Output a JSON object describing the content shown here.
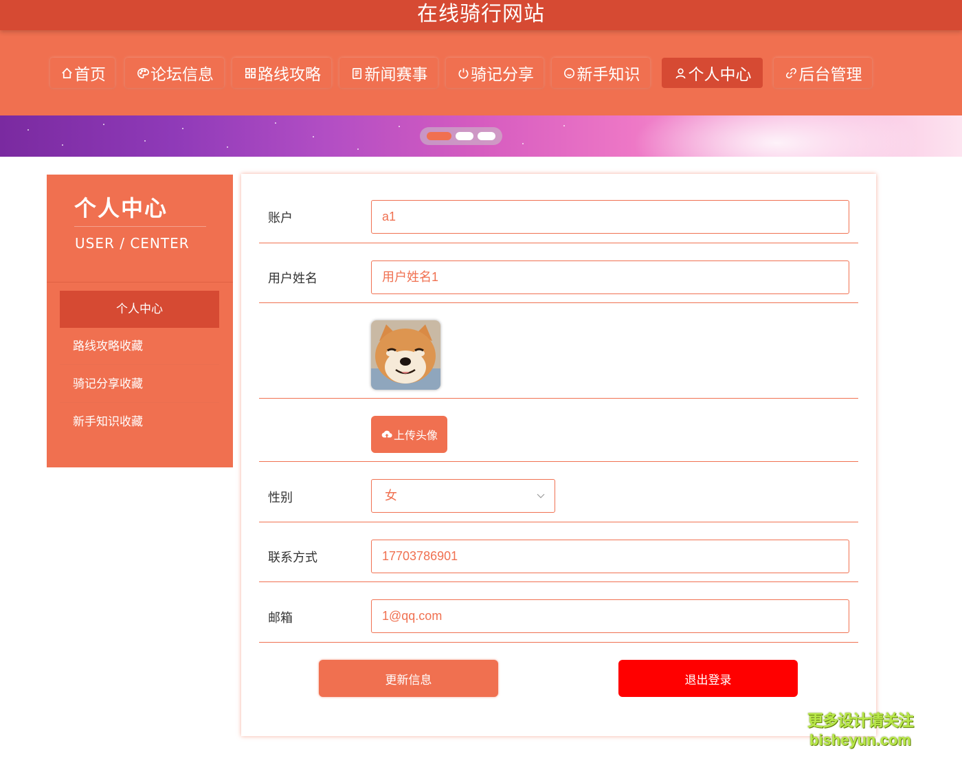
{
  "site": {
    "title": "在线骑行网站"
  },
  "nav": {
    "items": [
      {
        "label": "首页",
        "icon": "home-icon"
      },
      {
        "label": "论坛信息",
        "icon": "palette-icon"
      },
      {
        "label": "路线攻略",
        "icon": "grid-icon"
      },
      {
        "label": "新闻赛事",
        "icon": "clipboard-icon"
      },
      {
        "label": "骑记分享",
        "icon": "power-icon"
      },
      {
        "label": "新手知识",
        "icon": "circle-icon"
      },
      {
        "label": "个人中心",
        "icon": "user-icon",
        "active": true
      },
      {
        "label": "后台管理",
        "icon": "link-icon"
      }
    ]
  },
  "banner": {
    "slide_count": 3,
    "active_slide": 1
  },
  "sidebar": {
    "title": "个人中心",
    "subtitle": "USER / CENTER",
    "items": [
      {
        "label": "个人中心",
        "active": true
      },
      {
        "label": "路线攻略收藏"
      },
      {
        "label": "骑记分享收藏"
      },
      {
        "label": "新手知识收藏"
      }
    ]
  },
  "form": {
    "account_label": "账户",
    "account_value": "a1",
    "name_label": "用户姓名",
    "name_value": "用户姓名1",
    "upload_label": "上传头像",
    "gender_label": "性别",
    "gender_value": "女",
    "phone_label": "联系方式",
    "phone_value": "17703786901",
    "email_label": "邮箱",
    "email_value": "1@qq.com",
    "update_label": "更新信息",
    "logout_label": "退出登录"
  },
  "watermark": {
    "line1": "更多设计请关注",
    "line2": "bisheyun.com"
  },
  "colors": {
    "primary": "#f07050",
    "dark": "#d64a33",
    "danger": "#ff0000"
  }
}
